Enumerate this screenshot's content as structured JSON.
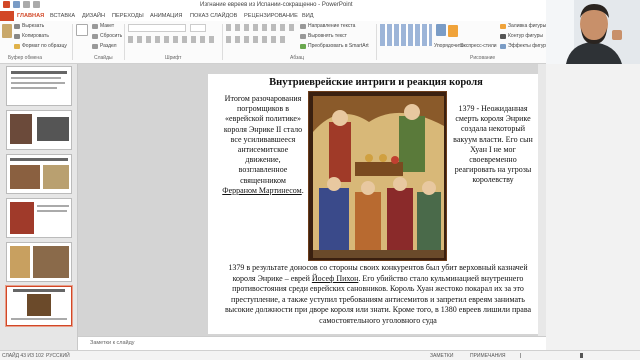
{
  "window": {
    "title": "Изгнание евреев из Испании-сокращенно - PowerPoint"
  },
  "tabs": [
    "ГЛАВНАЯ",
    "ВСТАВКА",
    "ДИЗАЙН",
    "ПЕРЕХОДЫ",
    "АНИМАЦИЯ",
    "ПОКАЗ СЛАЙДОВ",
    "РЕЦЕНЗИРОВАНИЕ",
    "ВИД"
  ],
  "ribbon": {
    "clipboard": {
      "cut": "Вырезать",
      "copy": "Копировать",
      "format": "Формат по образцу",
      "label": "Буфер обмена"
    },
    "slides": {
      "layout": "Макет",
      "reset": "Сбросить",
      "section": "Раздел",
      "label": "Слайды"
    },
    "font": {
      "label": "Шрифт"
    },
    "paragraph": {
      "direction": "Направление текста",
      "align": "Выровнять текст",
      "smartart": "Преобразовать в SmartArt",
      "label": "Абзац"
    },
    "drawing": {
      "label": "Рисование",
      "arrange": "Упорядочить",
      "styles": "Экспресс-стили"
    },
    "shape": {
      "fill": "Заливка фигуры",
      "outline": "Контур фигуры",
      "effects": "Эффекты фигуры"
    }
  },
  "slide": {
    "title": "Внутриеврейские интриги и реакция короля",
    "left_text": "Итогом разочарования погромщиков в «еврейской политике» короля Энрике II стало все усиливавшееся антисемитское движение, возглавленное священником",
    "left_link": "Ферраном Мартинесом",
    "left_end": ".",
    "right_text": "1379 - Неожиданная смерть короля Энрике создала некоторый вакуум власти. Его сын Хуан I не мог своевременно реагировать на угрозы королевству",
    "bottom_1": "1379 в результате доносов со стороны своих конкурентов был убит верховный казначей короля Энрике – еврей ",
    "bottom_link": "Йосеф Пихон",
    "bottom_2": ". Его убийство стало кульминацией внутреннего противостояния среди еврейских сановников. Король Хуан жестоко покарал их за это преступление, а также уступил требованиям антисемитов и запретил евреям занимать высокие должности при дворе короля или знати. Кроме того, в 1380 евреев лишили права самостоятельного уголовного суда"
  },
  "notes": {
    "placeholder": "Заметки к слайду"
  },
  "status": {
    "slide": "СЛАЙД 43 ИЗ 102",
    "lang": "РУССКИЙ",
    "notes_btn": "ЗАМЕТКИ",
    "comments_btn": "ПРИМЕЧАНИЯ"
  },
  "colors": {
    "accent": "#d24726",
    "ribbon": "#fbfbfb"
  }
}
